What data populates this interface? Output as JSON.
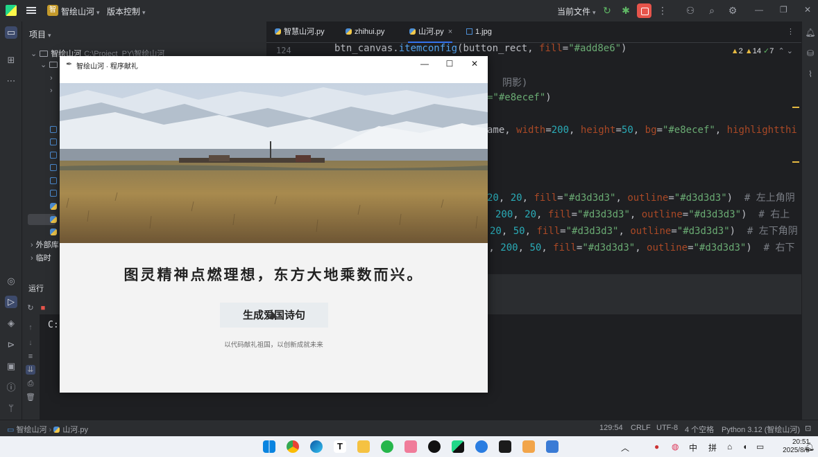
{
  "titlebar": {
    "project_badge": "智",
    "project_name": "智绘山河",
    "vcs_label": "版本控制",
    "current_file_label": "当前文件",
    "icons": [
      "hamburger-icon",
      "run-icon",
      "debug-icon",
      "stop-icon",
      "more-icon",
      "add-user-icon",
      "search-icon",
      "settings-icon"
    ]
  },
  "project_panel": {
    "header": "项目",
    "root_name": "智绘山河",
    "root_path": "C:\\Project_PY\\智绘山河",
    "external_libs": "外部库",
    "scratches": "临时"
  },
  "tabs": [
    {
      "label": "智慧山河.py",
      "type": "py"
    },
    {
      "label": "zhihui.py",
      "type": "py"
    },
    {
      "label": "山河.py",
      "type": "py",
      "active": true
    },
    {
      "label": "1.jpg",
      "type": "jpg"
    }
  ],
  "editor": {
    "line_number": "124",
    "inspections": {
      "warnings": "2",
      "weak_warnings": "14",
      "typos": "7"
    },
    "lines": [
      {
        "seg": [
          [
            "",
            "btn_canvas."
          ],
          [
            "fn",
            "itemconfig"
          ],
          [
            "",
            "(button_rect, "
          ],
          [
            "prm",
            "fill"
          ],
          [
            "",
            "="
          ],
          [
            "str",
            "\"#add8e6\""
          ],
          [
            "",
            ")"
          ]
        ]
      },
      {
        "seg": [
          [
            "cmt",
            "阴影)"
          ]
        ]
      },
      {
        "seg": [
          [
            "str",
            "=\"#e8ecef\""
          ],
          [
            "",
            ")"
          ]
        ]
      },
      {
        "seg": [
          [
            "",
            "ame, "
          ],
          [
            "prm",
            "width"
          ],
          [
            "",
            "="
          ],
          [
            "num",
            "200"
          ],
          [
            "",
            ", "
          ],
          [
            "prm",
            "height"
          ],
          [
            "",
            "="
          ],
          [
            "num",
            "50"
          ],
          [
            "",
            ", "
          ],
          [
            "prm",
            "bg"
          ],
          [
            "",
            "="
          ],
          [
            "str",
            "\"#e8ecef\""
          ],
          [
            "",
            ", "
          ],
          [
            "prm",
            "highlightthi"
          ]
        ]
      },
      {
        "seg": [
          [
            "num",
            "20"
          ],
          [
            "",
            ", "
          ],
          [
            "num",
            "20"
          ],
          [
            "",
            ", "
          ],
          [
            "prm",
            "fill"
          ],
          [
            "",
            "="
          ],
          [
            "str",
            "\"#d3d3d3\""
          ],
          [
            "",
            ", "
          ],
          [
            "prm",
            "outline"
          ],
          [
            "",
            "="
          ],
          [
            "str",
            "\"#d3d3d3\""
          ],
          [
            "",
            ")  "
          ],
          [
            "cmt",
            "# 左上角阴"
          ]
        ]
      },
      {
        "seg": [
          [
            "num",
            "200"
          ],
          [
            "",
            ", "
          ],
          [
            "num",
            "20"
          ],
          [
            "",
            ", "
          ],
          [
            "prm",
            "fill"
          ],
          [
            "",
            "="
          ],
          [
            "str",
            "\"#d3d3d3\""
          ],
          [
            "",
            ", "
          ],
          [
            "prm",
            "outline"
          ],
          [
            "",
            "="
          ],
          [
            "str",
            "\"#d3d3d3\""
          ],
          [
            "",
            ")  "
          ],
          [
            "cmt",
            "# 右上"
          ]
        ]
      },
      {
        "seg": [
          [
            "num",
            "20"
          ],
          [
            "",
            ", "
          ],
          [
            "num",
            "50"
          ],
          [
            "",
            ", "
          ],
          [
            "prm",
            "fill"
          ],
          [
            "",
            "="
          ],
          [
            "str",
            "\"#d3d3d3\""
          ],
          [
            "",
            ", "
          ],
          [
            "prm",
            "outline"
          ],
          [
            "",
            "="
          ],
          [
            "str",
            "\"#d3d3d3\""
          ],
          [
            "",
            ")  "
          ],
          [
            "cmt",
            "# 左下角阴"
          ]
        ]
      },
      {
        "seg": [
          [
            "",
            "), "
          ],
          [
            "num",
            "200"
          ],
          [
            "",
            ", "
          ],
          [
            "num",
            "50"
          ],
          [
            "",
            ", "
          ],
          [
            "prm",
            "fill"
          ],
          [
            "",
            "="
          ],
          [
            "str",
            "\"#d3d3d3\""
          ],
          [
            "",
            ", "
          ],
          [
            "prm",
            "outline"
          ],
          [
            "",
            "="
          ],
          [
            "str",
            "\"#d3d3d3\""
          ],
          [
            "",
            ")  "
          ],
          [
            "cmt",
            "# 右下"
          ]
        ]
      }
    ]
  },
  "run_panel": {
    "title": "运行",
    "console_text": "C:"
  },
  "statusbar": {
    "breadcrumb_project": "智绘山河",
    "breadcrumb_file": "山河.py",
    "position": "129:54",
    "line_sep": "CRLF",
    "encoding": "UTF-8",
    "indent": "4 个空格",
    "interpreter": "Python 3.12 (智绘山河)"
  },
  "app_window": {
    "title": "智绘山河 · 程序献礼",
    "poem": "图灵精神点燃理想，东方大地乘数而兴。",
    "button_label": "生成爱国诗句",
    "slogan": "以代码献礼祖国，以创新成就未来"
  },
  "taskbar": {
    "time": "20:51",
    "date": "2025/8/5",
    "ime_lang": "中",
    "ime_mode": "拼"
  },
  "colors": {
    "accent": "#3574f0",
    "stop_red": "#e5544b",
    "string_green": "#6aab73",
    "number_cyan": "#2aacb8",
    "param_orange": "#aa4926",
    "button_bg": "#e8ecef"
  }
}
